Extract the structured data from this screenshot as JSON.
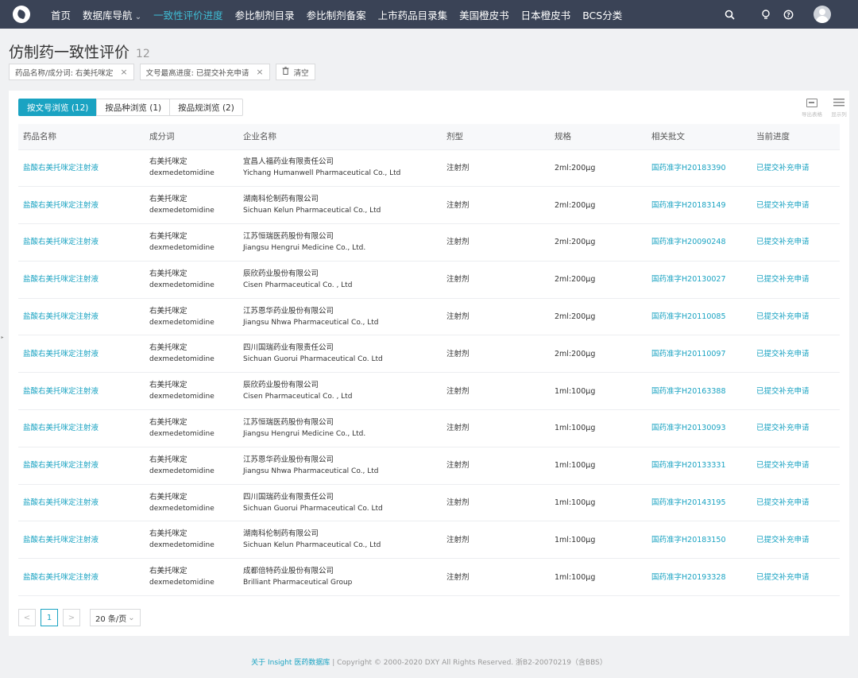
{
  "nav": {
    "items": [
      {
        "label": "首页",
        "active": false,
        "dropdown": false
      },
      {
        "label": "数据库导航",
        "active": false,
        "dropdown": true
      },
      {
        "label": "一致性评价进度",
        "active": true,
        "dropdown": false
      },
      {
        "label": "参比制剂目录",
        "active": false,
        "dropdown": false
      },
      {
        "label": "参比制剂备案",
        "active": false,
        "dropdown": false
      },
      {
        "label": "上市药品目录集",
        "active": false,
        "dropdown": false
      },
      {
        "label": "美国橙皮书",
        "active": false,
        "dropdown": false
      },
      {
        "label": "日本橙皮书",
        "active": false,
        "dropdown": false
      },
      {
        "label": "BCS分类",
        "active": false,
        "dropdown": false
      }
    ],
    "icons": [
      "search-icon",
      "bulb-icon",
      "help-icon",
      "avatar"
    ]
  },
  "page": {
    "title": "仿制药一致性评价",
    "count": "12"
  },
  "filters": [
    {
      "label": "药品名称/成分词: 右美托咪定",
      "remove": "×"
    },
    {
      "label": "文号最高进度: 已提交补充申请",
      "remove": "×"
    }
  ],
  "clear_label": "清空",
  "tabs": [
    {
      "label": "按文号浏览 (12)",
      "active": true
    },
    {
      "label": "按品种浏览 (1)",
      "active": false
    },
    {
      "label": "按品规浏览 (2)",
      "active": false
    }
  ],
  "tools": {
    "export_label": "导出表格",
    "columns_label": "显示列"
  },
  "table": {
    "headers": [
      "药品名称",
      "成分词",
      "企业名称",
      "剂型",
      "规格",
      "相关批文",
      "当前进度"
    ],
    "rows": [
      {
        "drug": "盐酸右美托咪定注射液",
        "ing_cn": "右美托咪定",
        "ing_en": "dexmedetomidine",
        "co_cn": "宜昌人福药业有限责任公司",
        "co_en": "Yichang Humanwell Pharmaceutical Co., Ltd",
        "form": "注射剂",
        "spec": "2ml:200μg",
        "approval": "国药准字H20183390",
        "progress": "已提交补充申请"
      },
      {
        "drug": "盐酸右美托咪定注射液",
        "ing_cn": "右美托咪定",
        "ing_en": "dexmedetomidine",
        "co_cn": "湖南科伦制药有限公司",
        "co_en": "Sichuan Kelun Pharmaceutical Co., Ltd",
        "form": "注射剂",
        "spec": "2ml:200μg",
        "approval": "国药准字H20183149",
        "progress": "已提交补充申请"
      },
      {
        "drug": "盐酸右美托咪定注射液",
        "ing_cn": "右美托咪定",
        "ing_en": "dexmedetomidine",
        "co_cn": "江苏恒瑞医药股份有限公司",
        "co_en": "Jiangsu Hengrui Medicine Co., Ltd.",
        "form": "注射剂",
        "spec": "2ml:200μg",
        "approval": "国药准字H20090248",
        "progress": "已提交补充申请"
      },
      {
        "drug": "盐酸右美托咪定注射液",
        "ing_cn": "右美托咪定",
        "ing_en": "dexmedetomidine",
        "co_cn": "辰欣药业股份有限公司",
        "co_en": "Cisen Pharmaceutical Co. , Ltd",
        "form": "注射剂",
        "spec": "2ml:200μg",
        "approval": "国药准字H20130027",
        "progress": "已提交补充申请"
      },
      {
        "drug": "盐酸右美托咪定注射液",
        "ing_cn": "右美托咪定",
        "ing_en": "dexmedetomidine",
        "co_cn": "江苏恩华药业股份有限公司",
        "co_en": "Jiangsu Nhwa Pharmaceutical Co., Ltd",
        "form": "注射剂",
        "spec": "2ml:200μg",
        "approval": "国药准字H20110085",
        "progress": "已提交补充申请"
      },
      {
        "drug": "盐酸右美托咪定注射液",
        "ing_cn": "右美托咪定",
        "ing_en": "dexmedetomidine",
        "co_cn": "四川国瑞药业有限责任公司",
        "co_en": "Sichuan Guorui Pharmaceutical Co. Ltd",
        "form": "注射剂",
        "spec": "2ml:200μg",
        "approval": "国药准字H20110097",
        "progress": "已提交补充申请"
      },
      {
        "drug": "盐酸右美托咪定注射液",
        "ing_cn": "右美托咪定",
        "ing_en": "dexmedetomidine",
        "co_cn": "辰欣药业股份有限公司",
        "co_en": "Cisen Pharmaceutical Co. , Ltd",
        "form": "注射剂",
        "spec": "1ml:100μg",
        "approval": "国药准字H20163388",
        "progress": "已提交补充申请"
      },
      {
        "drug": "盐酸右美托咪定注射液",
        "ing_cn": "右美托咪定",
        "ing_en": "dexmedetomidine",
        "co_cn": "江苏恒瑞医药股份有限公司",
        "co_en": "Jiangsu Hengrui Medicine Co., Ltd.",
        "form": "注射剂",
        "spec": "1ml:100μg",
        "approval": "国药准字H20130093",
        "progress": "已提交补充申请"
      },
      {
        "drug": "盐酸右美托咪定注射液",
        "ing_cn": "右美托咪定",
        "ing_en": "dexmedetomidine",
        "co_cn": "江苏恩华药业股份有限公司",
        "co_en": "Jiangsu Nhwa Pharmaceutical Co., Ltd",
        "form": "注射剂",
        "spec": "1ml:100μg",
        "approval": "国药准字H20133331",
        "progress": "已提交补充申请"
      },
      {
        "drug": "盐酸右美托咪定注射液",
        "ing_cn": "右美托咪定",
        "ing_en": "dexmedetomidine",
        "co_cn": "四川国瑞药业有限责任公司",
        "co_en": "Sichuan Guorui Pharmaceutical Co. Ltd",
        "form": "注射剂",
        "spec": "1ml:100μg",
        "approval": "国药准字H20143195",
        "progress": "已提交补充申请"
      },
      {
        "drug": "盐酸右美托咪定注射液",
        "ing_cn": "右美托咪定",
        "ing_en": "dexmedetomidine",
        "co_cn": "湖南科伦制药有限公司",
        "co_en": "Sichuan Kelun Pharmaceutical Co., Ltd",
        "form": "注射剂",
        "spec": "1ml:100μg",
        "approval": "国药准字H20183150",
        "progress": "已提交补充申请"
      },
      {
        "drug": "盐酸右美托咪定注射液",
        "ing_cn": "右美托咪定",
        "ing_en": "dexmedetomidine",
        "co_cn": "成都倍特药业股份有限公司",
        "co_en": "Brilliant Pharmaceutical Group",
        "form": "注射剂",
        "spec": "1ml:100μg",
        "approval": "国药准字H20193328",
        "progress": "已提交补充申请"
      }
    ]
  },
  "pager": {
    "prev": "<",
    "current": "1",
    "next": ">",
    "page_size": "20 条/页"
  },
  "footer": {
    "link": "关于 Insight 医药数据库",
    "text": " | Copyright © 2000-2020 DXY All Rights Reserved. 浙B2-20070219（含BBS）"
  },
  "colors": {
    "nav_bg": "#3a4356",
    "accent": "#1aa3c2",
    "nav_active": "#3fbcd4"
  }
}
